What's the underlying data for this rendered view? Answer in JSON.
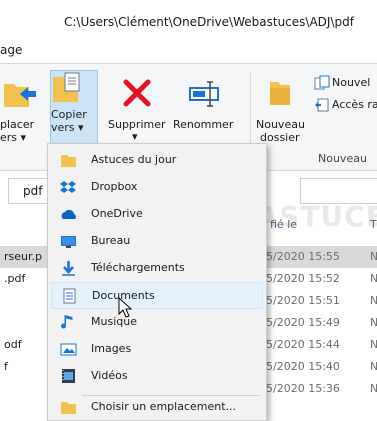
{
  "window": {
    "path": "C:\\Users\\Clément\\OneDrive\\Webastuces\\ADJ\\pdf"
  },
  "ribbon": {
    "tab_fragment": "age",
    "move_label_line1": "placer",
    "move_label_line2": "ers ▾",
    "copy_label_line1": "Copier",
    "copy_label_line2": "vers ▾",
    "delete_label": "Supprimer",
    "delete_arrow": "▾",
    "rename_label": "Renommer",
    "new_folder_line1": "Nouveau",
    "new_folder_line2": "dossier",
    "new_item_label": "Nouvel",
    "easy_access_label": "Accès ra",
    "group_new_label": "Nouveau"
  },
  "address": {
    "current": "pdf"
  },
  "watermark": {
    "text": "BIG ASTUCES"
  },
  "filelist": {
    "header_date": "fié le",
    "header_type": "T",
    "rows": [
      {
        "name": "rseur.p",
        "date": "5/2020 15:55",
        "type": "N",
        "selected": true
      },
      {
        "name": ".pdf",
        "date": "5/2020 15:52",
        "type": "N"
      },
      {
        "name": "",
        "date": "5/2020 15:51",
        "type": "N"
      },
      {
        "name": "",
        "date": "5/2020 15:49",
        "type": "N"
      },
      {
        "name": "odf",
        "date": "5/2020 15:44",
        "type": "N"
      },
      {
        "name": "f",
        "date": "5/2020 15:40",
        "type": "N"
      },
      {
        "name": "",
        "date": "5/2020 15:36",
        "type": "N"
      }
    ]
  },
  "menu": {
    "items": [
      {
        "label": "Astuces du jour",
        "icon": "folder-icon"
      },
      {
        "label": "Dropbox",
        "icon": "dropbox-icon"
      },
      {
        "label": "OneDrive",
        "icon": "onedrive-icon"
      },
      {
        "label": "Bureau",
        "icon": "desktop-icon"
      },
      {
        "label": "Téléchargements",
        "icon": "download-icon"
      },
      {
        "label": "Documents",
        "icon": "documents-icon",
        "hover": true
      },
      {
        "label": "Musique",
        "icon": "music-icon"
      },
      {
        "label": "Images",
        "icon": "images-icon"
      },
      {
        "label": "Vidéos",
        "icon": "videos-icon"
      }
    ],
    "choose_label": "Choisir un emplacement..."
  },
  "colors": {
    "folder": "#f2c14e",
    "accent_blue": "#1a73d9",
    "delete_red": "#e81123",
    "selected_bg": "#cce4f7",
    "hover_bg": "#e5f1fb"
  }
}
